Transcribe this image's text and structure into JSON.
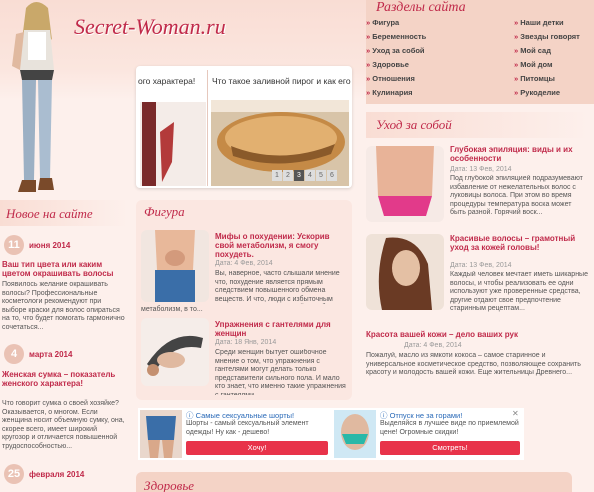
{
  "site": {
    "logo": "Secret-Woman.ru"
  },
  "slider": {
    "captions": [
      "ого характера!",
      "Что такое заливной пирог и как его"
    ],
    "pages": [
      "1",
      "2",
      "3",
      "4",
      "5",
      "6"
    ],
    "active_page": "3"
  },
  "razdely": {
    "title": "Разделы сайта",
    "col1": [
      "Фигура",
      "Беременность",
      "Уход за собой",
      "Здоровье",
      "Отношения",
      "Кулинария"
    ],
    "col2": [
      "Наши детки",
      "Звезды говорят",
      "Мой сад",
      "Мой дом",
      "Питомцы",
      "Рукоделие"
    ]
  },
  "new_on_site": {
    "title": "Новое на сайте",
    "items": [
      {
        "day": "11",
        "month": "июня 2014",
        "title": "Ваш тип цвета или каким цветом окрашивать волосы",
        "text": "Появилось желание окрашивать волосы? Профессиональные косметологи рекомендуют при выборе краски для волос опираться на то, что будет помогать гармонично сочетаться..."
      },
      {
        "day": "4",
        "month": "марта 2014",
        "title": "Женская сумка – показатель женского характера!",
        "text": "Что говорит сумка о своей хозяйке? Оказывается, о многом. Если женщина носит объемную сумку, она, скорее всего, имеет широкий кругозор и отличается повышенной трудоспособностью..."
      },
      {
        "day": "25",
        "month": "февраля 2014",
        "title": "",
        "text": ""
      }
    ]
  },
  "figura": {
    "title": "Фигура",
    "items": [
      {
        "title": "Мифы о похудении: Ускорив свой метаболизм, я смогу похудеть.",
        "date": "Дата: 4 Фев, 2014",
        "text": "Вы, наверное, часто слышали мнение что, похудение является прямым следствием повышенного обмена веществ. И что, люди с избыточным весом имеют замедленный метаболизм, в то..."
      },
      {
        "title": "Упражнения с гантелями для женщин",
        "date": "Дата: 18 Янв, 2014",
        "text": "Среди женщин бытует ошибочное мнение о том, что упражнения с гантелями могут делать только представители сильного пола. И мало кто знает, что именно такие упражнения с гантелями..."
      }
    ]
  },
  "uhod": {
    "title": "Уход за собой",
    "items": [
      {
        "title": "Глубокая эпиляция: виды и их особенности",
        "date": "Дата: 13 Фев, 2014",
        "text": "Под глубокой эпиляцией подразумевают избавление от нежелательных волос с луковицы волоса. При этом во время процедуры температура воска может быть разной. Горячий воск..."
      },
      {
        "title": "Красивые волосы – грамотный уход за кожей головы!",
        "date": "Дата: 13 Фев, 2014",
        "text": "Каждый человек мечтает иметь шикарные волосы, и чтобы реализовать ее одни используют уже проверенные средства, другие отдают свое предпочтение старинным рецептам..."
      },
      {
        "title": "Красота вашей кожи – дело ваших рук",
        "date": "Дата: 4 Фев, 2014",
        "text": "Пожалуй, масло из ямкоти кокоса – самое старинное и универсальное косметическое средство, позволяющее сохранить красоту и молодость вашей кожи. Еще жительницы Древнего..."
      }
    ]
  },
  "ads": [
    {
      "title": "Самые сексуальные шорты!",
      "text": "Шорты - самый сексуальный элемент одежды! Ну как - дешево!",
      "button": "Хочу!"
    },
    {
      "title": "Отпуск не за горами!",
      "text": "Выделяйся в лучшее виде по приемлемой цене! Огромные скидки!",
      "button": "Смотреть!"
    }
  ],
  "bottom": {
    "title": "Здоровье"
  },
  "colors": {
    "accent": "#c02a4a",
    "bg": "#fdf0ec",
    "nav_bg": "#f4d3c6"
  }
}
